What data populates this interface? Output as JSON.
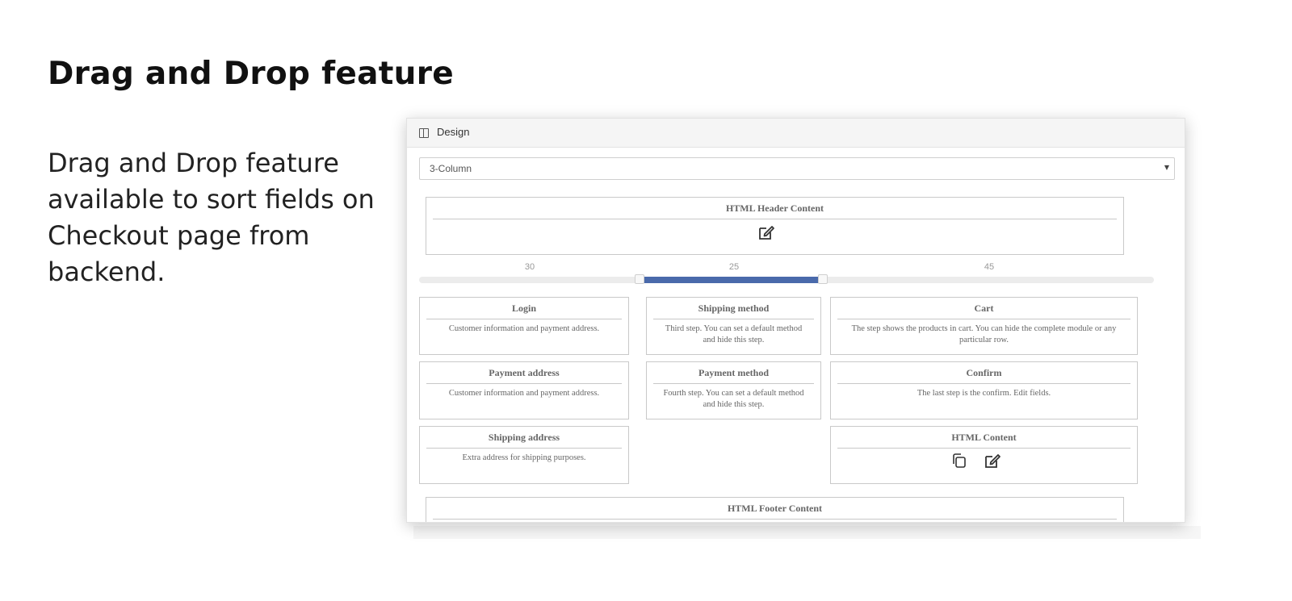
{
  "intro": {
    "title": "Drag and Drop feature",
    "description": "Drag and Drop feature available to sort fields on Checkout page from backend."
  },
  "panel": {
    "title": "Design",
    "icon": "columns-icon",
    "layout_select": {
      "value": "3-Column"
    },
    "header_block": {
      "title": "HTML Header Content",
      "icon": "edit-icon"
    },
    "slider": {
      "values": [
        30,
        25,
        45
      ],
      "labels": [
        "30",
        "25",
        "45"
      ],
      "accent": "#4a6aab"
    },
    "columns": {
      "left": [
        {
          "title": "Login",
          "desc": "Customer information and payment address."
        },
        {
          "title": "Payment address",
          "desc": "Customer information and payment address."
        },
        {
          "title": "Shipping address",
          "desc": "Extra address for shipping purposes."
        }
      ],
      "middle": [
        {
          "title": "Shipping method",
          "desc": "Third step. You can set a default method and hide this step."
        },
        {
          "title": "Payment method",
          "desc": "Fourth step. You can set a default method and hide this step."
        }
      ],
      "right": [
        {
          "title": "Cart",
          "desc": "The step shows the products in cart. You can hide the complete module or any particular row."
        },
        {
          "title": "Confirm",
          "desc": "The last step is the confirm. Edit fields."
        },
        {
          "title": "HTML Content",
          "icons": [
            "copy-icon",
            "edit-icon"
          ]
        }
      ]
    },
    "footer_block": {
      "title": "HTML Footer Content"
    }
  }
}
